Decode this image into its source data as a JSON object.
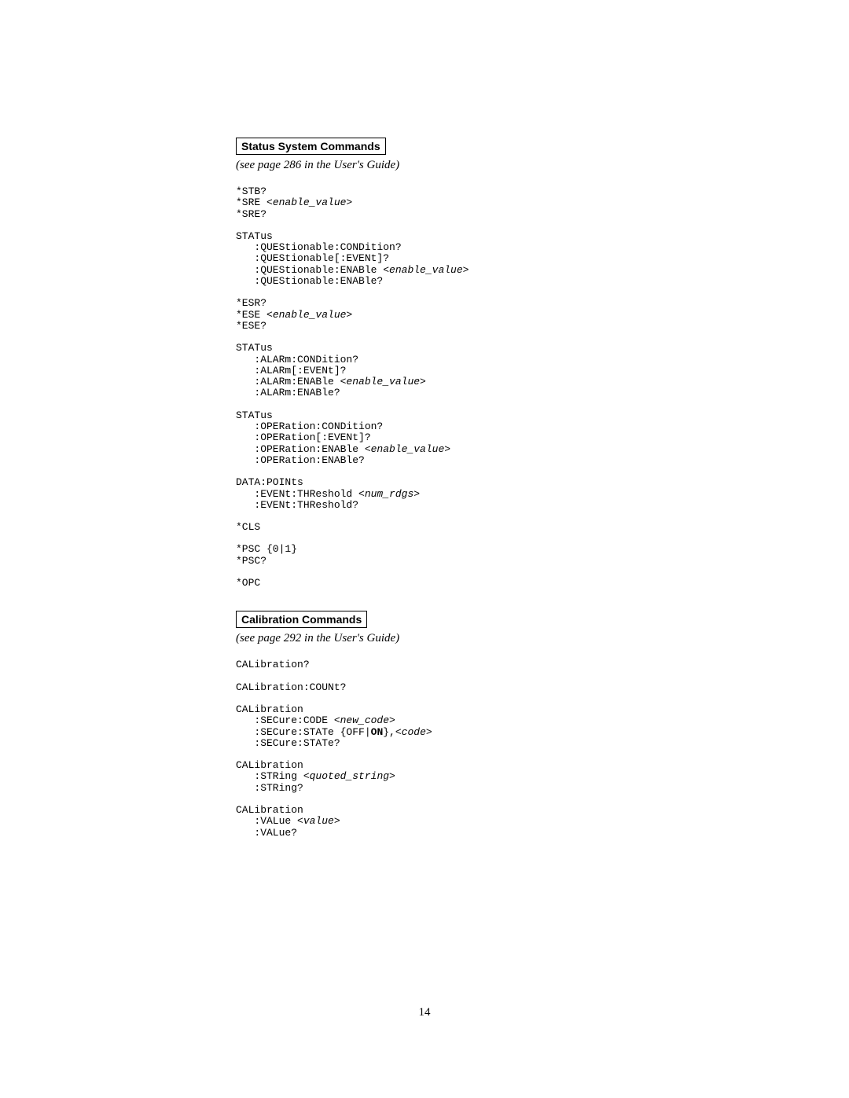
{
  "sections": [
    {
      "title": "Status System Commands",
      "see": "(see page 286 in the User's Guide)",
      "blocks": [
        [
          {
            "t": "*STB?"
          },
          {
            "t": "*SRE ",
            "p": "<enable_value>"
          },
          {
            "t": "*SRE?"
          }
        ],
        [
          {
            "t": "STATus"
          },
          {
            "t": "   :QUEStionable:CONDition?"
          },
          {
            "t": "   :QUEStionable[:EVENt]?"
          },
          {
            "t": "   :QUEStionable:ENABle ",
            "p": "<enable_value>"
          },
          {
            "t": "   :QUEStionable:ENABle?"
          }
        ],
        [
          {
            "t": "*ESR?"
          },
          {
            "t": "*ESE ",
            "p": "<enable_value>"
          },
          {
            "t": "*ESE?"
          }
        ],
        [
          {
            "t": "STATus"
          },
          {
            "t": "   :ALARm:CONDition?"
          },
          {
            "t": "   :ALARm[:EVENt]?"
          },
          {
            "t": "   :ALARm:ENABle ",
            "p": "<enable_value>"
          },
          {
            "t": "   :ALARm:ENABle?"
          }
        ],
        [
          {
            "t": "STATus"
          },
          {
            "t": "   :OPERation:CONDition?"
          },
          {
            "t": "   :OPERation[:EVENt]?"
          },
          {
            "t": "   :OPERation:ENABle ",
            "p": "<enable_value>"
          },
          {
            "t": "   :OPERation:ENABle?"
          }
        ],
        [
          {
            "t": "DATA:POINts"
          },
          {
            "t": "   :EVENt:THReshold ",
            "p": "<num_rdgs>"
          },
          {
            "t": "   :EVENt:THReshold?"
          }
        ],
        [
          {
            "t": "*CLS"
          }
        ],
        [
          {
            "t": "*PSC {0|1}"
          },
          {
            "t": "*PSC?"
          }
        ],
        [
          {
            "t": "*OPC"
          }
        ]
      ]
    },
    {
      "title": "Calibration Commands",
      "see": "(see page 292 in the User's Guide)",
      "blocks": [
        [
          {
            "t": "CALibration?"
          }
        ],
        [
          {
            "t": "CALibration:COUNt?"
          }
        ],
        [
          {
            "t": "CALibration"
          },
          {
            "t": "   :SECure:CODE ",
            "p": "<new_code>"
          },
          {
            "t": "   :SECure:STATe {OFF|",
            "b": "ON",
            "t2": "},",
            "p2": "<code>"
          },
          {
            "t": "   :SECure:STATe?"
          }
        ],
        [
          {
            "t": "CALibration"
          },
          {
            "t": "   :STRing ",
            "p": "<quoted_string>"
          },
          {
            "t": "   :STRing?"
          }
        ],
        [
          {
            "t": "CALibration"
          },
          {
            "t": "   :VALue ",
            "p": "<value>"
          },
          {
            "t": "   :VALue?"
          }
        ]
      ]
    }
  ],
  "pageNumber": "14"
}
